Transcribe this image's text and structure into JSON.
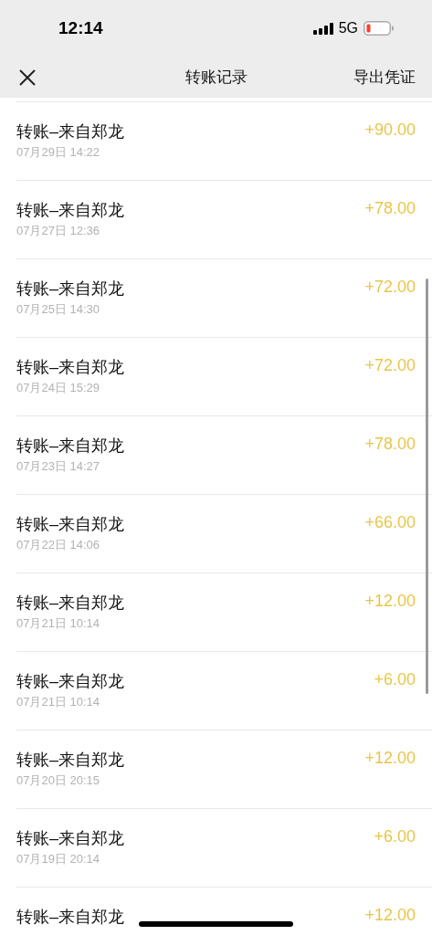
{
  "status_bar": {
    "time": "12:14",
    "network": "5G"
  },
  "nav": {
    "title": "转账记录",
    "action": "导出凭证"
  },
  "records": [
    {
      "title": "转账–来自郑龙",
      "time": "07月29日 14:22",
      "amount": "+90.00"
    },
    {
      "title": "转账–来自郑龙",
      "time": "07月27日 12:36",
      "amount": "+78.00"
    },
    {
      "title": "转账–来自郑龙",
      "time": "07月25日 14:30",
      "amount": "+72.00"
    },
    {
      "title": "转账–来自郑龙",
      "time": "07月24日 15:29",
      "amount": "+72.00"
    },
    {
      "title": "转账–来自郑龙",
      "time": "07月23日 14:27",
      "amount": "+78.00"
    },
    {
      "title": "转账–来自郑龙",
      "time": "07月22日 14:06",
      "amount": "+66.00"
    },
    {
      "title": "转账–来自郑龙",
      "time": "07月21日 10:14",
      "amount": "+12.00"
    },
    {
      "title": "转账–来自郑龙",
      "time": "07月21日 10:14",
      "amount": "+6.00"
    },
    {
      "title": "转账–来自郑龙",
      "time": "07月20日 20:15",
      "amount": "+12.00"
    },
    {
      "title": "转账–来自郑龙",
      "time": "07月19日 20:14",
      "amount": "+6.00"
    },
    {
      "title": "转账–来自郑龙",
      "amount": "+12.00"
    }
  ]
}
